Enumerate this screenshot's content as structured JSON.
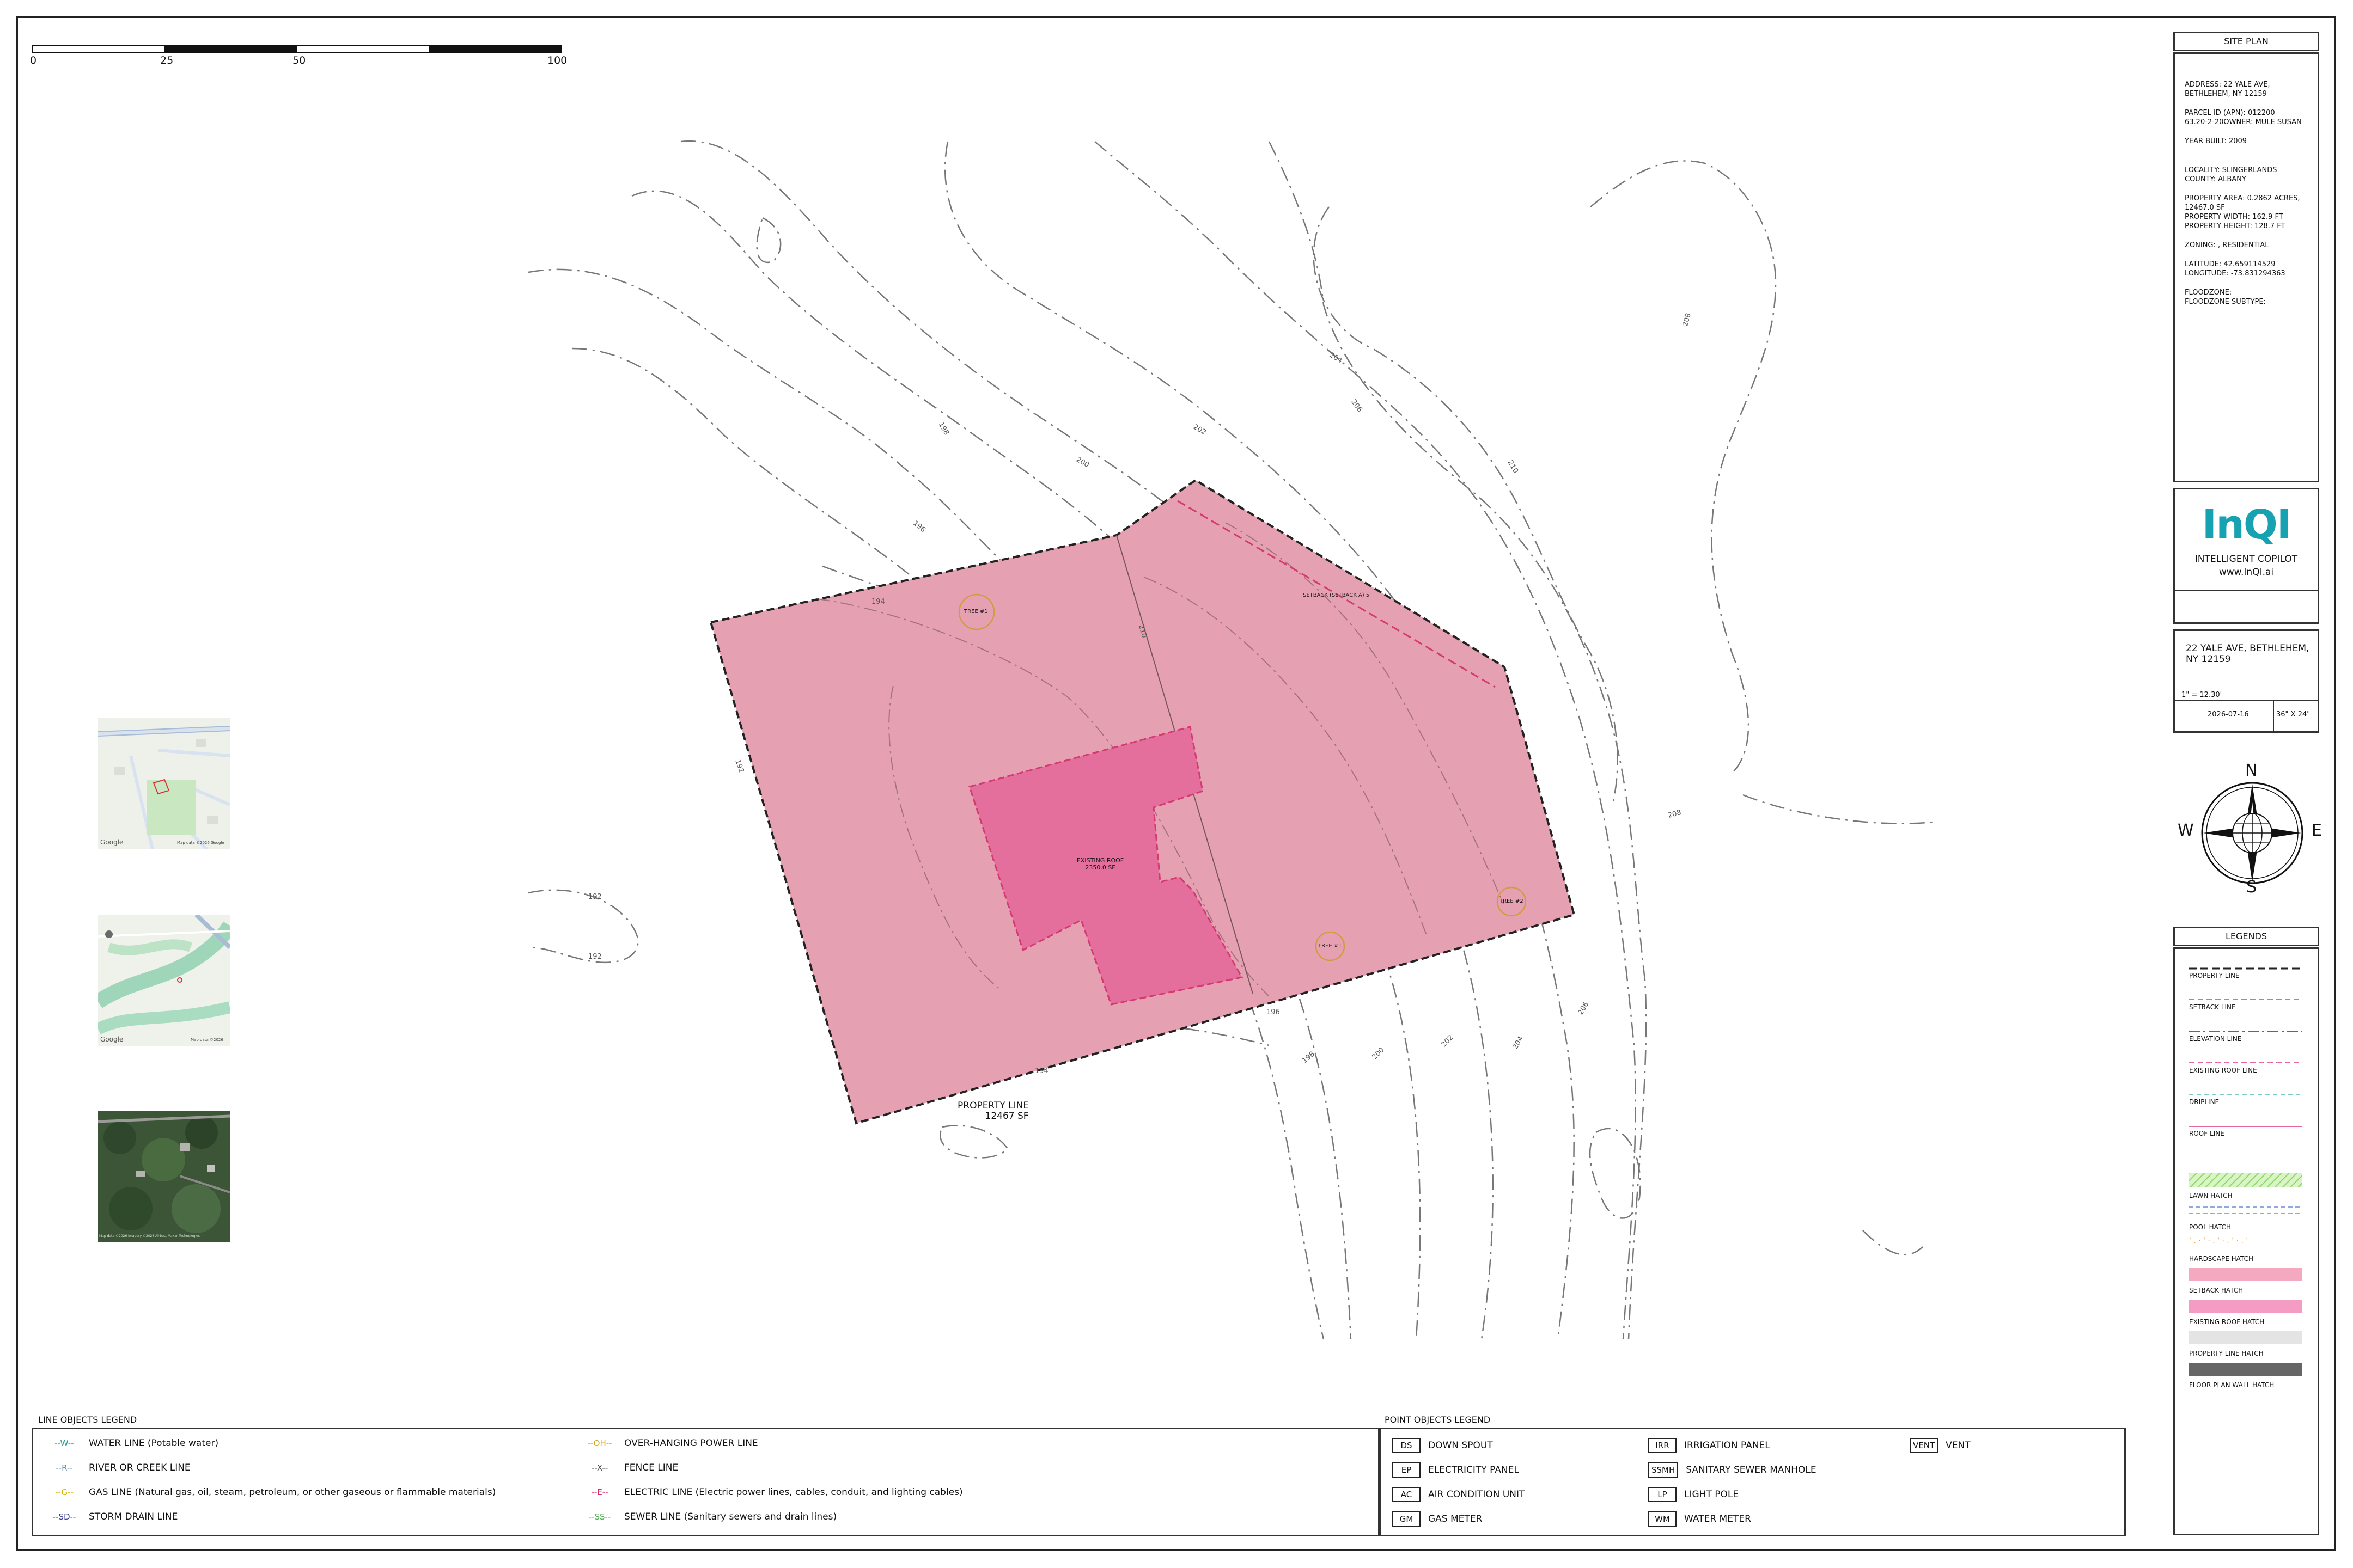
{
  "scale_bar": {
    "labels": [
      "0",
      "25",
      "50",
      "100"
    ]
  },
  "site_plan": {
    "title": "SITE PLAN",
    "info_lines": [
      "ADDRESS: 22 YALE AVE,",
      "BETHLEHEM, NY 12159",
      "",
      "PARCEL ID (APN): 012200",
      "63.20-2-20OWNER: MULE SUSAN",
      "",
      "YEAR BUILT: 2009",
      "",
      "",
      "LOCALITY: SLINGERLANDS",
      "COUNTY: ALBANY",
      "",
      "PROPERTY AREA: 0.2862 ACRES,",
      "12467.0 SF",
      "PROPERTY WIDTH: 162.9 FT",
      "PROPERTY HEIGHT: 128.7 FT",
      "",
      "ZONING: , RESIDENTIAL",
      "",
      "LATITUDE: 42.659114529",
      "LONGITUDE: -73.831294363",
      "",
      "FLOODZONE:",
      "FLOODZONE SUBTYPE:"
    ]
  },
  "brand": {
    "logo_text": "InQI",
    "tagline": "INTELLIGENT COPILOT",
    "url": "www.InQI.ai",
    "color": "#17a2b2"
  },
  "project": {
    "address": "22 YALE AVE, BETHLEHEM, NY 12159",
    "scale": "1\" = 12.30'",
    "date": "2026-07-16",
    "sheet_size": "36\" X 24\""
  },
  "compass": {
    "n": "N",
    "s": "S",
    "e": "E",
    "w": "W"
  },
  "legends": {
    "title": "LEGENDS",
    "items": [
      {
        "label": "PROPERTY LINE",
        "color": "#222222"
      },
      {
        "label": "SETBACK LINE",
        "color": "#e8669c"
      },
      {
        "label": "ELEVATION LINE",
        "color": "#666666"
      },
      {
        "label": "EXISTING ROOF LINE",
        "color": "#e8669c"
      },
      {
        "label": "DRIPLINE",
        "color": "#7fc9c0"
      },
      {
        "label": "ROOF LINE",
        "color": "#e8669c"
      },
      {
        "label": "LAWN HATCH",
        "color": "#9ee07a"
      },
      {
        "label": "POOL HATCH",
        "color": "#8fa8e0"
      },
      {
        "label": "HARDSCAPE HATCH",
        "color": "#e0a040"
      },
      {
        "label": "SETBACK HATCH",
        "color": "#f4a9c0"
      },
      {
        "label": "EXISTING ROOF HATCH",
        "color": "#f49cc4"
      },
      {
        "label": "PROPERTY LINE HATCH",
        "color": "#e4e4e4"
      },
      {
        "label": "FLOOR PLAN WALL HATCH",
        "color": "#666666"
      }
    ]
  },
  "plan": {
    "property_label": "PROPERTY LINE",
    "property_area": "12467 SF",
    "roof_label": "EXISTING ROOF",
    "roof_area": "2350.0 SF",
    "setback_label": "SETBACK (SETBACK A) 5'",
    "trees": [
      "TREE #1",
      "TREE #2",
      "TREE #1"
    ],
    "contours": [
      "192",
      "192",
      "192",
      "194",
      "194",
      "196",
      "196",
      "198",
      "198",
      "200",
      "200",
      "202",
      "202",
      "204",
      "204",
      "206",
      "206",
      "208",
      "208",
      "210",
      "210"
    ]
  },
  "line_objects": {
    "title": "LINE OBJECTS LEGEND",
    "items": [
      {
        "sym": "W",
        "label": "WATER LINE (Potable water)",
        "color": "#2a9d8f"
      },
      {
        "sym": "R",
        "label": "RIVER OR CREEK LINE",
        "color": "#6a8caf"
      },
      {
        "sym": "G",
        "label": "GAS LINE (Natural gas, oil, steam, petroleum, or other gaseous or flammable materials)",
        "color": "#d4b106"
      },
      {
        "sym": "SD",
        "label": "STORM DRAIN LINE",
        "color": "#3d3d8f"
      },
      {
        "sym": "OH",
        "label": "OVER-HANGING POWER LINE",
        "color": "#d4a017"
      },
      {
        "sym": "X",
        "label": "FENCE LINE",
        "color": "#444444"
      },
      {
        "sym": "E",
        "label": "ELECTRIC LINE (Electric power lines, cables, conduit, and lighting cables)",
        "color": "#d62c5f"
      },
      {
        "sym": "SS",
        "label": "SEWER LINE (Sanitary sewers and drain lines)",
        "color": "#4caf50"
      }
    ]
  },
  "point_objects": {
    "title": "POINT OBJECTS LEGEND",
    "items": [
      {
        "code": "DS",
        "label": "DOWN SPOUT"
      },
      {
        "code": "EP",
        "label": "ELECTRICITY PANEL"
      },
      {
        "code": "AC",
        "label": "AIR CONDITION UNIT"
      },
      {
        "code": "GM",
        "label": "GAS METER"
      },
      {
        "code": "IRR",
        "label": "IRRIGATION PANEL"
      },
      {
        "code": "SSMH",
        "label": "SANITARY SEWER MANHOLE"
      },
      {
        "code": "LP",
        "label": "LIGHT POLE"
      },
      {
        "code": "WM",
        "label": "WATER METER"
      },
      {
        "code": "VENT",
        "label": "VENT"
      }
    ]
  },
  "thumbnails": {
    "map_credit": "Map data ©2026 Google",
    "terrain_credit": "Map data ©2026",
    "satellite_credit": "Map data ©2026 Imagery ©2026 Airbus, Maxar Technologies",
    "google": "Google"
  }
}
